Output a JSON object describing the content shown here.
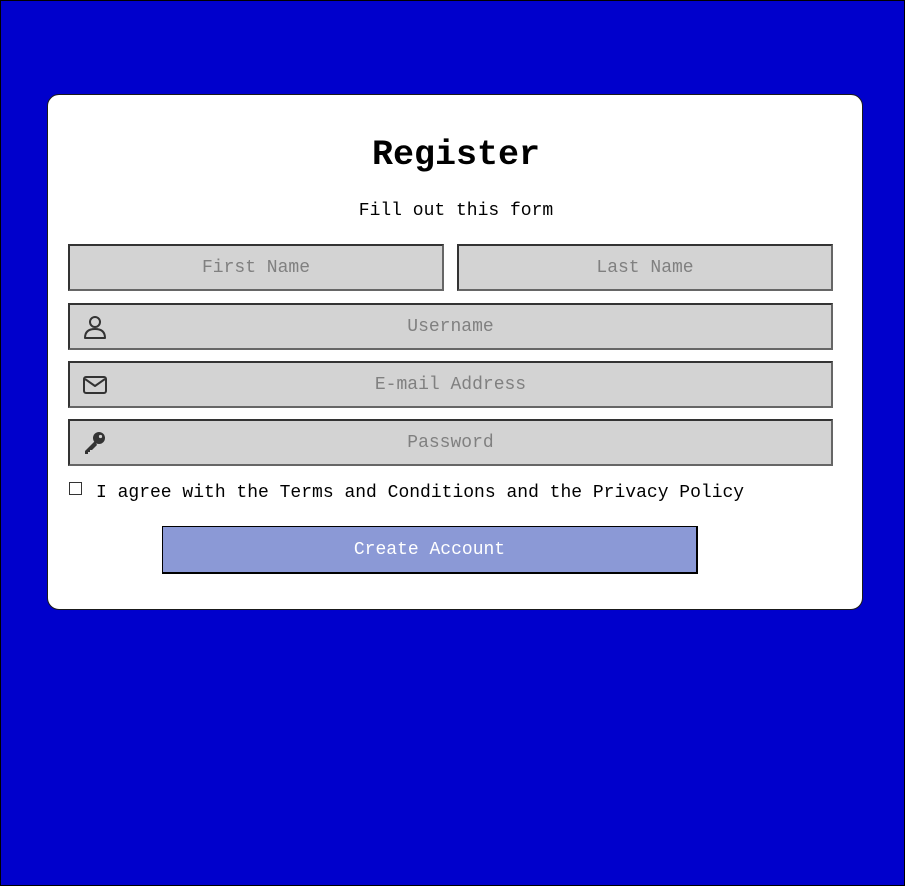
{
  "form": {
    "title": "Register",
    "subtitle": "Fill out this form",
    "first_name_placeholder": "First Name",
    "last_name_placeholder": "Last Name",
    "username_placeholder": "Username",
    "email_placeholder": "E-mail Address",
    "password_placeholder": "Password",
    "agree_text": "I agree with the Terms and Conditions and the Privacy Policy",
    "agree_checked": false,
    "submit_label": "Create Account"
  },
  "icons": {
    "username": "user-icon",
    "email": "envelope-icon",
    "password": "key-icon"
  },
  "colors": {
    "background": "#0000cc",
    "card": "#ffffff",
    "input": "#d3d3d3",
    "button": "#8b99d6"
  }
}
